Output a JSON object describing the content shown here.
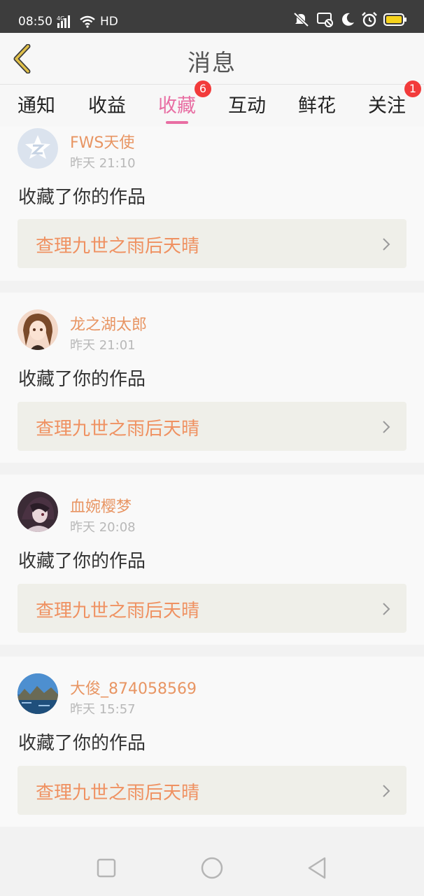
{
  "status_bar": {
    "time": "08:50",
    "network": "4G",
    "hd": "HD",
    "icons": [
      "signal-icon",
      "wifi-icon",
      "mute-icon",
      "cast-off-icon",
      "moon-icon",
      "alarm-icon",
      "battery-icon"
    ]
  },
  "header": {
    "title": "消息",
    "back_icon": "chevron-left-icon",
    "accent": "#e0c04a"
  },
  "tabs": [
    {
      "label": "通知",
      "active": false,
      "badge": ""
    },
    {
      "label": "收益",
      "active": false,
      "badge": ""
    },
    {
      "label": "收藏",
      "active": true,
      "badge": "6"
    },
    {
      "label": "互动",
      "active": false,
      "badge": ""
    },
    {
      "label": "鲜花",
      "active": false,
      "badge": ""
    },
    {
      "label": "关注",
      "active": false,
      "badge": "1"
    }
  ],
  "messages": [
    {
      "user": "FWS天使",
      "time": "昨天 21:10",
      "action": "收藏了你的作品",
      "work": "查理九世之雨后天晴",
      "avatar": "default-qzone-avatar"
    },
    {
      "user": "龙之湖太郎",
      "time": "昨天 21:01",
      "action": "收藏了你的作品",
      "work": "查理九世之雨后天晴",
      "avatar": "anime-girl-avatar"
    },
    {
      "user": "血婉樱梦",
      "time": "昨天 20:08",
      "action": "收藏了你的作品",
      "work": "查理九世之雨后天晴",
      "avatar": "dark-anime-avatar"
    },
    {
      "user": "大俊_874058569",
      "time": "昨天 15:57",
      "action": "收藏了你的作品",
      "work": "查理九世之雨后天晴",
      "avatar": "landscape-avatar"
    }
  ],
  "colors": {
    "accent_pink": "#e86ea3",
    "badge_red": "#f23b3b",
    "name_orange": "#e89563",
    "work_orange": "#ef9161"
  },
  "nav": [
    "recents-square-icon",
    "home-circle-icon",
    "back-triangle-icon"
  ]
}
